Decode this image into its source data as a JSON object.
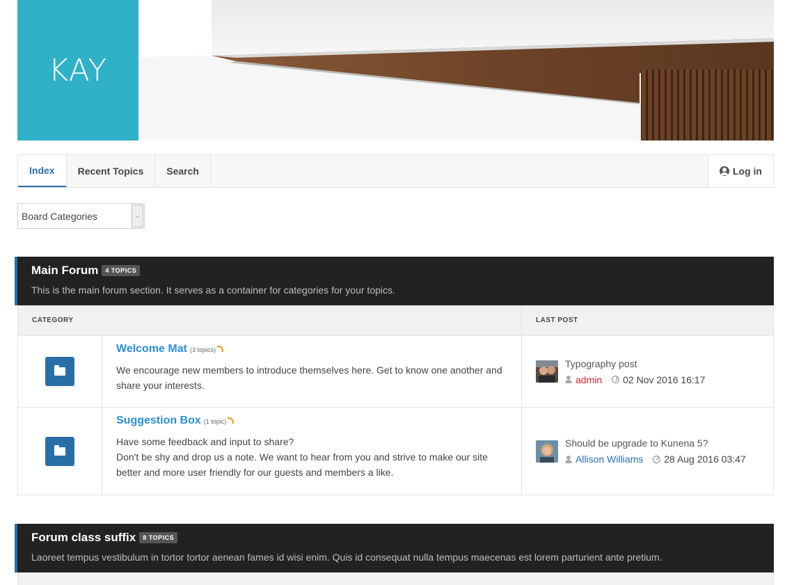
{
  "brand": {
    "logo_text": "KAY",
    "logo_color": "#2fb1c8"
  },
  "nav": {
    "tabs": [
      {
        "label": "Index",
        "active": true
      },
      {
        "label": "Recent Topics",
        "active": false
      },
      {
        "label": "Search",
        "active": false
      }
    ],
    "login_label": "Log in"
  },
  "board_select": {
    "selected": "Board Categories"
  },
  "sections": [
    {
      "title": "Main Forum",
      "badge": "4 TOPICS",
      "description": "This is the main forum section. It serves as a container for categories for your topics.",
      "columns": {
        "category": "CATEGORY",
        "last_post": "LAST POST"
      },
      "categories": [
        {
          "name": "Welcome Mat",
          "topic_count": "(3 topics)",
          "description": "We encourage new members to introduce themselves here. Get to know one another and share your interests.",
          "last_post": {
            "title": "Typography post",
            "author": "admin",
            "author_color": "#e0232f",
            "date": "02 Nov 2016 16:17"
          }
        },
        {
          "name": "Suggestion Box",
          "topic_count": "(1 topic)",
          "description_lines": [
            "Have some feedback and input to share?",
            "Don't be shy and drop us a note. We want to hear from you and strive to make our site better and more user friendly for our guests and members a like."
          ],
          "last_post": {
            "title": "Should be upgrade to Kunena 5?",
            "author": "Allison Williams",
            "author_color": "#2a6ea8",
            "date": "28 Aug 2016 03:47"
          }
        }
      ]
    },
    {
      "title": "Forum class suffix",
      "badge": "8 TOPICS",
      "description": "Laoreet tempus vestibulum in tortor tortor aenean fames id wisi enim. Quis id consequat nulla tempus maecenas est lorem parturient ante pretium."
    }
  ],
  "colors": {
    "accent": "#2a6ea8",
    "link": "#2a8fd8",
    "section_bg": "#222222",
    "rss": "#f39c12"
  }
}
